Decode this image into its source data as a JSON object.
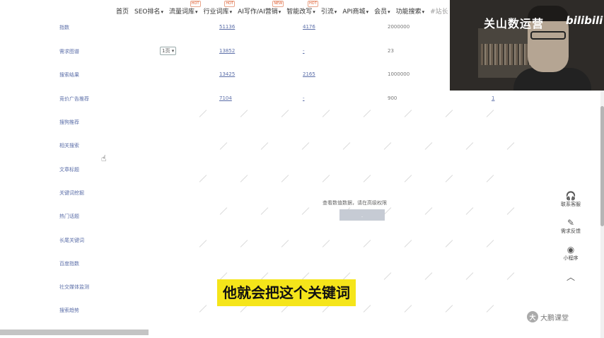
{
  "topnav": {
    "items": [
      {
        "label": "首页",
        "caret": false,
        "hot": ""
      },
      {
        "label": "SEO排名",
        "caret": true,
        "hot": ""
      },
      {
        "label": "流量词库",
        "caret": true,
        "hot": "HOT"
      },
      {
        "label": "行业词库",
        "caret": true,
        "hot": "HOT"
      },
      {
        "label": "AI写作/AI营销",
        "caret": true,
        "hot": "NEW"
      },
      {
        "label": "智能改写",
        "caret": true,
        "hot": "HOT"
      },
      {
        "label": "引流",
        "caret": true,
        "hot": ""
      },
      {
        "label": "API商城",
        "caret": true,
        "hot": ""
      },
      {
        "label": "会员",
        "caret": true,
        "hot": ""
      },
      {
        "label": "功能搜索",
        "caret": true,
        "hot": ""
      },
      {
        "label": "#站长",
        "caret": false,
        "hot": ""
      }
    ]
  },
  "table": {
    "rows": [
      {
        "name": "指数",
        "c1": "51136",
        "c2": "4176",
        "c3": "2000000",
        "c4": "",
        "dropdown": ""
      },
      {
        "name": "需求图谱",
        "c1": "13852",
        "c2": "-",
        "c3": "23",
        "c4": "",
        "dropdown": "1页"
      },
      {
        "name": "搜索结果",
        "c1": "13425",
        "c2": "2165",
        "c3": "1000000",
        "c4": "",
        "dropdown": ""
      },
      {
        "name": "竞价广告推荐",
        "c1": "7104",
        "c2": "-",
        "c3": "900",
        "c4": "1",
        "dropdown": ""
      },
      {
        "name": "搜狗推荐",
        "c1": "",
        "c2": "",
        "c3": "",
        "c4": "",
        "dropdown": ""
      },
      {
        "name": "相关搜索",
        "c1": "",
        "c2": "",
        "c3": "",
        "c4": "",
        "dropdown": ""
      },
      {
        "name": "文章标题",
        "c1": "",
        "c2": "",
        "c3": "",
        "c4": "",
        "dropdown": ""
      },
      {
        "name": "关键词挖掘",
        "c1": "",
        "c2": "",
        "c3": "",
        "c4": "",
        "dropdown": ""
      },
      {
        "name": "热门话题",
        "c1": "",
        "c2": "",
        "c3": "",
        "c4": "",
        "dropdown": ""
      },
      {
        "name": "长尾关键词",
        "c1": "",
        "c2": "",
        "c3": "",
        "c4": "",
        "dropdown": ""
      },
      {
        "name": "百度指数",
        "c1": "",
        "c2": "",
        "c3": "",
        "c4": "",
        "dropdown": ""
      },
      {
        "name": "社交媒体监测",
        "c1": "",
        "c2": "",
        "c3": "",
        "c4": "",
        "dropdown": ""
      },
      {
        "name": "搜索趋势",
        "c1": "",
        "c2": "",
        "c3": "",
        "c4": "",
        "dropdown": ""
      }
    ]
  },
  "permission": {
    "text": "查看数值数据，请在高级权限",
    "button_label": "."
  },
  "webcam": {
    "brand": "关山数运营",
    "platform": "bilibili"
  },
  "sidebar": {
    "items": [
      {
        "label": "联系客服",
        "icon": "headset-icon"
      },
      {
        "label": "需求反馈",
        "icon": "feedback-icon"
      },
      {
        "label": "小程序",
        "icon": "miniprogram-icon"
      }
    ]
  },
  "subtitle": "他就会把这个关键词",
  "watermark": {
    "logo_text": "大",
    "label": "大鹏课堂"
  },
  "colors": {
    "subtitle_bg": "#f5e51a",
    "link": "#5b6ea8",
    "hot_badge": "#e05a2b"
  }
}
